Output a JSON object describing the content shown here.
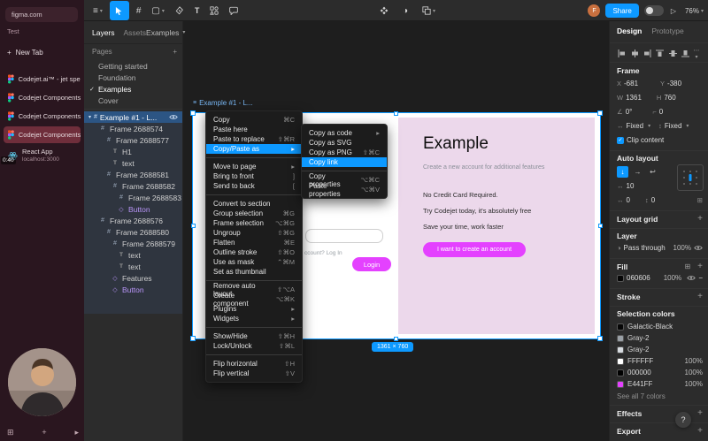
{
  "colors": {
    "accent_blue": "#0d99ff",
    "magenta": "#e441ff",
    "panel_pink": "#ecd8eb",
    "sidebar_maroon": "#2a161f",
    "canvas_dark": "#1e1e1e"
  },
  "browser": {
    "url_pill": "figma.com",
    "workspace": "Test",
    "new_tab": "New Tab",
    "timer": "0:40",
    "tabs": [
      {
        "label": "Codejet.ai™ - jet speed..."
      },
      {
        "label": "Codejet Components –..."
      },
      {
        "label": "Codejet Components –..."
      },
      {
        "label": "Codejet Components (..."
      },
      {
        "label": "React App",
        "sublabel": "localhost:3000"
      }
    ]
  },
  "toolbar": {
    "share_label": "Share",
    "zoom_level": "76%",
    "avatar_initial": "F"
  },
  "layers": {
    "tab_layers": "Layers",
    "tab_assets": "Assets",
    "page_dropdown": "Examples",
    "pages_header": "Pages",
    "pages": [
      {
        "label": "Getting started"
      },
      {
        "label": "Foundation"
      },
      {
        "label": "Examples",
        "check": "✓"
      },
      {
        "label": "Cover"
      }
    ],
    "tree": [
      {
        "label": "Example #1 - L..."
      },
      {
        "label": "Frame 2688574"
      },
      {
        "label": "Frame 2688577"
      },
      {
        "label": "H1"
      },
      {
        "label": "text"
      },
      {
        "label": "Frame 2688581"
      },
      {
        "label": "Frame 2688582"
      },
      {
        "label": "Frame 2688583"
      },
      {
        "label": "Button"
      },
      {
        "label": "Frame 2688576"
      },
      {
        "label": "Frame 2688580"
      },
      {
        "label": "Frame 2688579"
      },
      {
        "label": "text"
      },
      {
        "label": "text"
      },
      {
        "label": "Features"
      },
      {
        "label": "Button"
      }
    ]
  },
  "canvas": {
    "frame_title": "Example #1 - L...",
    "size_badge": "1361 × 760",
    "login_form": {
      "fragment_text": "ccount? Log In",
      "login_button": "Login"
    },
    "promo": {
      "heading": "Example",
      "subheading": "Create a new account for additional features",
      "bullet1": "No Credit Card Required.",
      "bullet2": "Try Codejet today, it's absolutely free",
      "bullet3": "Save your time, work faster",
      "cta": "I want to create an account"
    }
  },
  "context_menu": {
    "items": [
      {
        "label": "Copy",
        "shortcut": "⌘C"
      },
      {
        "label": "Paste here"
      },
      {
        "label": "Paste to replace",
        "shortcut": "⇧⌘R"
      },
      {
        "label": "Copy/Paste as"
      },
      {
        "label": "Move to page"
      },
      {
        "label": "Bring to front",
        "shortcut": "]"
      },
      {
        "label": "Send to back",
        "shortcut": "["
      },
      {
        "label": "Convert to section"
      },
      {
        "label": "Group selection",
        "shortcut": "⌘G"
      },
      {
        "label": "Frame selection",
        "shortcut": "⌥⌘G"
      },
      {
        "label": "Ungroup",
        "shortcut": "⇧⌘G"
      },
      {
        "label": "Flatten",
        "shortcut": "⌘E"
      },
      {
        "label": "Outline stroke",
        "shortcut": "⇧⌘O"
      },
      {
        "label": "Use as mask",
        "shortcut": "⌃⌘M"
      },
      {
        "label": "Set as thumbnail"
      },
      {
        "label": "Remove auto layout",
        "shortcut": "⇧⌥A"
      },
      {
        "label": "Create component",
        "shortcut": "⌥⌘K"
      },
      {
        "label": "Plugins"
      },
      {
        "label": "Widgets"
      },
      {
        "label": "Show/Hide",
        "shortcut": "⇧⌘H"
      },
      {
        "label": "Lock/Unlock",
        "shortcut": "⇧⌘L"
      },
      {
        "label": "Flip horizontal",
        "shortcut": "⇧H"
      },
      {
        "label": "Flip vertical",
        "shortcut": "⇧V"
      }
    ]
  },
  "submenu": {
    "items": [
      {
        "label": "Copy as code"
      },
      {
        "label": "Copy as SVG"
      },
      {
        "label": "Copy as PNG",
        "shortcut": "⇧⌘C"
      },
      {
        "label": "Copy link"
      },
      {
        "label": "Copy properties",
        "shortcut": "⌥⌘C"
      },
      {
        "label": "Paste properties",
        "shortcut": "⌥⌘V"
      }
    ]
  },
  "design": {
    "tab_design": "Design",
    "tab_prototype": "Prototype",
    "frame": {
      "header": "Frame",
      "x_label": "X",
      "x": "-681",
      "y_label": "Y",
      "y": "-380",
      "w_label": "W",
      "w": "1361",
      "h_label": "H",
      "h": "760",
      "rotation": "0°",
      "radius": "0",
      "h_resize": "Fixed",
      "v_resize": "Fixed",
      "clip": "Clip content"
    },
    "auto_layout": {
      "header": "Auto layout",
      "spacing": "10",
      "padding_h": "0",
      "padding_v": "0"
    },
    "layout_grid_header": "Layout grid",
    "layer": {
      "header": "Layer",
      "blend": "Pass through",
      "opacity": "100%"
    },
    "fill": {
      "header": "Fill",
      "hex": "060606",
      "opacity": "100%"
    },
    "stroke_header": "Stroke",
    "selection_colors": {
      "header": "Selection colors",
      "rows": [
        {
          "name": "Galactic-Black",
          "swatch": "#060606"
        },
        {
          "name": "Gray-2",
          "swatch": "#9aa0a6"
        },
        {
          "name": "Gray-2",
          "swatch": "#d7dbe0"
        },
        {
          "name": "FFFFFF",
          "swatch": "#ffffff",
          "opacity": "100%"
        },
        {
          "name": "000000",
          "swatch": "#000000",
          "opacity": "100%"
        },
        {
          "name": "E441FF",
          "swatch": "#e441ff",
          "opacity": "100%"
        }
      ],
      "see_all": "See all 7 colors"
    },
    "effects_header": "Effects",
    "export_header": "Export"
  },
  "help": {
    "label": "?"
  }
}
